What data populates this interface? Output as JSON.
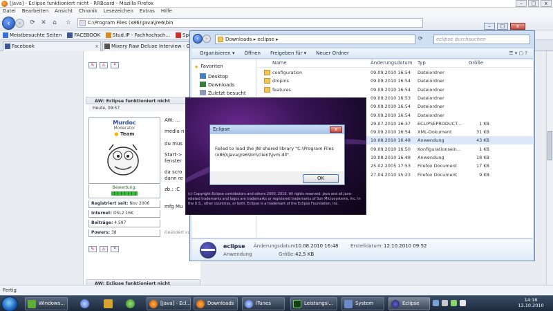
{
  "firefox": {
    "title": "[Java] - Eclipse funktioniert nicht - RRBoard - Mozilla Firefox",
    "win_buttons": [
      "–",
      "□",
      "x"
    ],
    "menu": [
      "Datei",
      "Bearbeiten",
      "Ansicht",
      "Chronik",
      "Lesezeichen",
      "Extras",
      "Hilfe"
    ],
    "url": "C:\\Program Files (x86)\\Java\\jre6\\bin",
    "bookmarks": [
      {
        "label": "Meistbesuchte Seiten",
        "color": "#3a6fd8"
      },
      {
        "label": "FACEBOOK",
        "color": "#3b5998"
      },
      {
        "label": "Stud.IP - Fachhochsch...",
        "color": "#d98a1c"
      },
      {
        "label": "Spit-TV.de",
        "color": "#c8322a"
      }
    ],
    "tabs": [
      {
        "label": "Facebook",
        "color": "#3b5998"
      },
      {
        "label": "Mixery Raw Deluxe Interview - Online ...",
        "color": "#555555"
      }
    ],
    "status": "Fertig"
  },
  "forum": {
    "post_title": "AW: Eclipse funktioniert nicht",
    "post_date": "Heute, 09:57",
    "user": {
      "name": "Murdoc",
      "role": "Moderator",
      "team": "Team",
      "rating_label": "Bewertung:"
    },
    "info": [
      {
        "label": "Registriert seit:",
        "value": "Nov 2006"
      },
      {
        "label": "Internet:",
        "value": "DSL2 16K"
      },
      {
        "label": "Beiträge:",
        "value": "4.597"
      },
      {
        "label": "Powers:",
        "value": "38"
      }
    ],
    "post_lines": [
      "AW: ...",
      "media n",
      "du mus",
      "Start->",
      "fenster",
      "da scro",
      "dann re",
      "zb.: :C",
      "mfg Mu"
    ],
    "edited": "Geändert von",
    "post_title_2": "AW: Eclipse funktioniert nicht"
  },
  "explorer": {
    "path": "Downloads  ▸  eclipse  ▸",
    "search_placeholder": "eclipse durchsuchen",
    "toolbar": [
      "Organisieren ▾",
      "Öffnen",
      "Freigeben für ▾",
      "Neuer Ordner"
    ],
    "nav": [
      "Favoriten",
      "Desktop",
      "Downloads",
      "Zuletzt besucht"
    ],
    "columns": [
      "Name",
      "Änderungsdatum",
      "Typ",
      "Größe"
    ],
    "files": [
      {
        "name": "configuration",
        "date": "09.09.2010 16:54",
        "type": "Dateiordner",
        "size": ""
      },
      {
        "name": "dropins",
        "date": "09.09.2010 16:54",
        "type": "Dateiordner",
        "size": ""
      },
      {
        "name": "features",
        "date": "09.09.2010 16:54",
        "type": "Dateiordner",
        "size": ""
      },
      {
        "name": "",
        "date": "09.09.2010 16:53",
        "type": "Dateiordner",
        "size": ""
      },
      {
        "name": "",
        "date": "09.09.2010 16:54",
        "type": "Dateiordner",
        "size": ""
      },
      {
        "name": "",
        "date": "09.09.2010 16:54",
        "type": "Dateiordner",
        "size": ""
      },
      {
        "name": "",
        "date": "29.07.2010 16:37",
        "type": "ECLIPSEPRODUCT...",
        "size": "1 KB"
      },
      {
        "name": "",
        "date": "09.09.2010 16:54",
        "type": "XML-Dokument",
        "size": "31 KB"
      },
      {
        "name": "",
        "date": "10.08.2010 16:48",
        "type": "Anwendung",
        "size": "43 KB"
      },
      {
        "name": "",
        "date": "09.09.2010 16:50",
        "type": "Konfigurationsein...",
        "size": "1 KB"
      },
      {
        "name": "",
        "date": "10.08.2010 16:48",
        "type": "Anwendung",
        "size": "18 KB"
      },
      {
        "name": "",
        "date": "25.02.2005 17:53",
        "type": "Firefox Document",
        "size": "17 KB"
      },
      {
        "name": "",
        "date": "27.04.2010 15:23",
        "type": "Firefox Document",
        "size": "9 KB"
      }
    ],
    "details": {
      "name": "eclipse",
      "kind": "Anwendung",
      "date_label": "Änderungsdatum:",
      "date": "10.08.2010 16:48",
      "created_label": "Erstelldatum:",
      "created": "12.10.2010 09:52",
      "size_label": "Größe:",
      "size": "42,5 KB"
    }
  },
  "splash": {
    "copyright": "(c) Copyright Eclipse contributors and others 2000, 2010. All rights reserved. Java and all Java-related trademarks and logos are trademarks or registered trademarks of Sun Microsystems, Inc. in the U.S., other countries, or both. Eclipse is a trademark of the Eclipse Foundation, Inc."
  },
  "dialog": {
    "title": "Eclipse",
    "close": "x",
    "message": "Failed to load the JNI shared library \"C:\\Program Files (x86)\\Java\\jre6\\bin\\client\\jvm.dll\".",
    "ok": "OK"
  },
  "taskbar": {
    "items": [
      {
        "label": "Windows...",
        "color": "#5fae3a"
      },
      {
        "label": "[Java] - Ecl...",
        "color": "#e56b12"
      },
      {
        "label": "Downloads",
        "color": "#e56b12"
      },
      {
        "label": "iTunes",
        "color": "#8aa6d9"
      },
      {
        "label": "Leistungsi...",
        "color": "#3a7a3a"
      },
      {
        "label": "System",
        "color": "#6b8bc8"
      },
      {
        "label": "Eclipse",
        "color": "#2b2b7a"
      }
    ],
    "time": "14:18",
    "date": "13.10.2010"
  }
}
